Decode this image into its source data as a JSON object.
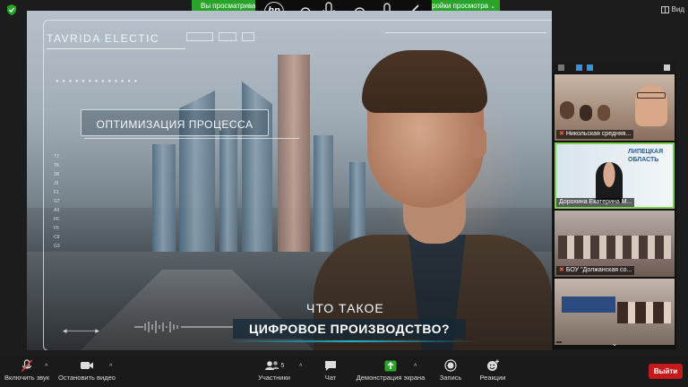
{
  "top": {
    "sharing_banner": "Вы просматриваете",
    "options_banner": "ройки просмотра",
    "view_label": "Вид"
  },
  "video": {
    "brand": "TAVRIDA ELECTIC",
    "process_label": "ОПТИМИЗАЦИЯ ПРОЦЕССА",
    "question_line1": "ЧТО ТАКОЕ",
    "question_line2": "ЦИФРОВОЕ ПРОИЗВОДСТВО?",
    "scale": [
      "TJ",
      "TK",
      "3R",
      "J9",
      "F1",
      "G7",
      "A9",
      "F6",
      "F5",
      "C9",
      "G3"
    ]
  },
  "gallery": {
    "tiles": [
      {
        "name": "Никольская средняя..."
      },
      {
        "name": "Дорохина Екатерина М..."
      },
      {
        "name": "БОУ \"Должанская со..."
      },
      {
        "name": ""
      }
    ]
  },
  "toolbar": {
    "mute": "Включить звук",
    "video": "Остановить видео",
    "participants": "Участники",
    "participants_count": "5",
    "chat": "Чат",
    "share": "Демонстрация экрана",
    "record": "Запись",
    "reactions": "Реакции",
    "leave": "Выйти"
  },
  "colors": {
    "accent_green": "#2aa32a",
    "leave_red": "#c41a1a",
    "active_speaker": "#7cd14a"
  }
}
